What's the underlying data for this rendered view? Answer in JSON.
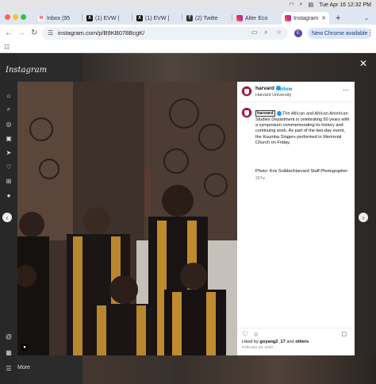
{
  "menubar": {
    "datetime": "Tue Apr 16  12:32 PM"
  },
  "tabs": [
    {
      "title": "Inbox (95",
      "icon": "gmail-icon",
      "color": "#ea4335",
      "glyph": "M"
    },
    {
      "title": "(1) EVW |",
      "icon": "x-icon",
      "color": "#111111",
      "glyph": "X"
    },
    {
      "title": "(1) EVW |",
      "icon": "x-icon",
      "color": "#111111",
      "glyph": "X"
    },
    {
      "title": "(2) Twitte",
      "icon": "twitter-icon",
      "color": "#333333",
      "glyph": "T"
    },
    {
      "title": "Alter Eco",
      "icon": "instagram-icon",
      "color": "#d6249f",
      "glyph": ""
    },
    {
      "title": "Instagram",
      "icon": "instagram-icon",
      "color": "#d6249f",
      "glyph": ""
    }
  ],
  "addressbar": {
    "url": "instagram.com/p/B9KB078BcgK/",
    "new_chrome_label": "New Chrome available",
    "profile_initial": "E"
  },
  "instagram": {
    "logo": "Instagram",
    "more_label": "More"
  },
  "post": {
    "username": "harvard",
    "follow_label": "Follow",
    "subname": "Harvard University",
    "mention": "harvard",
    "caption": "The African and African American Studies Department is celebrating 50 years with a symposium commemorating its history and continuing work. As part of the two-day event, the Kuumba Singers performed in Memorial Church on Friday.",
    "credit": "Photo: Kris Snibbe/Harvard Staff Photographer",
    "age": "267w",
    "liked_prefix": "Liked by ",
    "liked_user": "goyang2_17",
    "liked_suffix": " and ",
    "liked_others": "others",
    "date": "February 28, 2020"
  },
  "colors": {
    "instagram_blue": "#0095f6",
    "harvard_crimson": "#a41034"
  }
}
